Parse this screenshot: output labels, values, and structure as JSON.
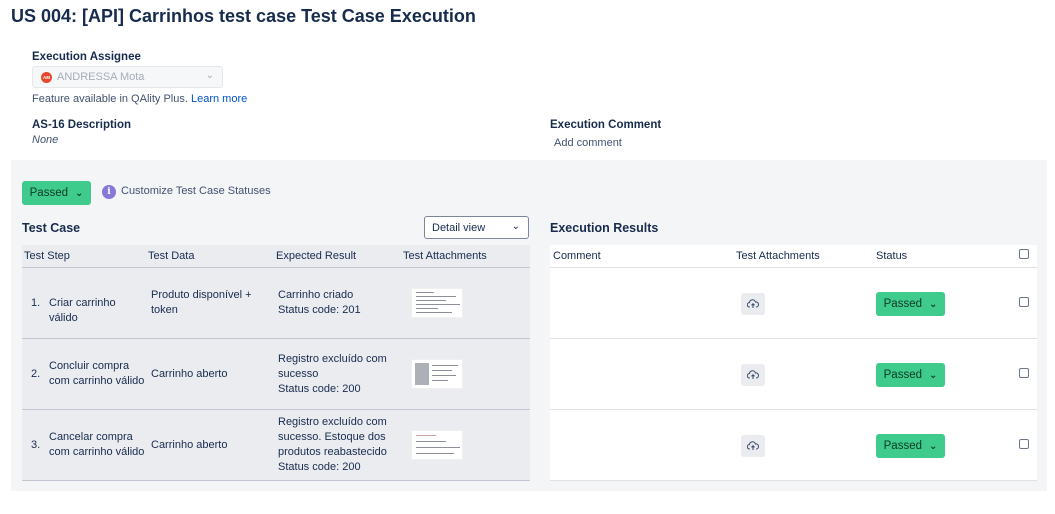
{
  "page": {
    "title": "US 004: [API] Carrinhos test case Test Case Execution"
  },
  "assignee": {
    "label": "Execution Assignee",
    "avatar_initials": "AM",
    "value": "ANDRESSA Mota",
    "note": "Feature available in QAlity Plus.",
    "learn_more": "Learn more"
  },
  "description": {
    "label": "AS-16 Description",
    "value": "None"
  },
  "execution_comment": {
    "label": "Execution Comment",
    "placeholder": "Add comment"
  },
  "status": {
    "overall": "Passed",
    "customize_label": "Customize Test Case Statuses",
    "color": "#3ecb8c"
  },
  "test_case": {
    "title": "Test Case",
    "view_select": "Detail view",
    "columns": [
      "Test Step",
      "Test Data",
      "Expected Result",
      "Test Attachments"
    ],
    "rows": [
      {
        "num": "1.",
        "step": "Criar carrinho válido",
        "data": "Produto disponível + token",
        "expected": "Carrinho criado\nStatus code: 201"
      },
      {
        "num": "2.",
        "step": "Concluir compra com carrinho válido",
        "data": "Carrinho aberto",
        "expected": "Registro excluído com sucesso\nStatus code: 200"
      },
      {
        "num": "3.",
        "step": "Cancelar compra com carrinho válido",
        "data": "Carrinho aberto",
        "expected": "Registro excluído com sucesso. Estoque dos produtos reabastecido\nStatus code: 200"
      }
    ]
  },
  "execution_results": {
    "title": "Execution Results",
    "columns": [
      "Comment",
      "Test Attachments",
      "Status"
    ],
    "rows": [
      {
        "status": "Passed"
      },
      {
        "status": "Passed"
      },
      {
        "status": "Passed"
      }
    ]
  }
}
